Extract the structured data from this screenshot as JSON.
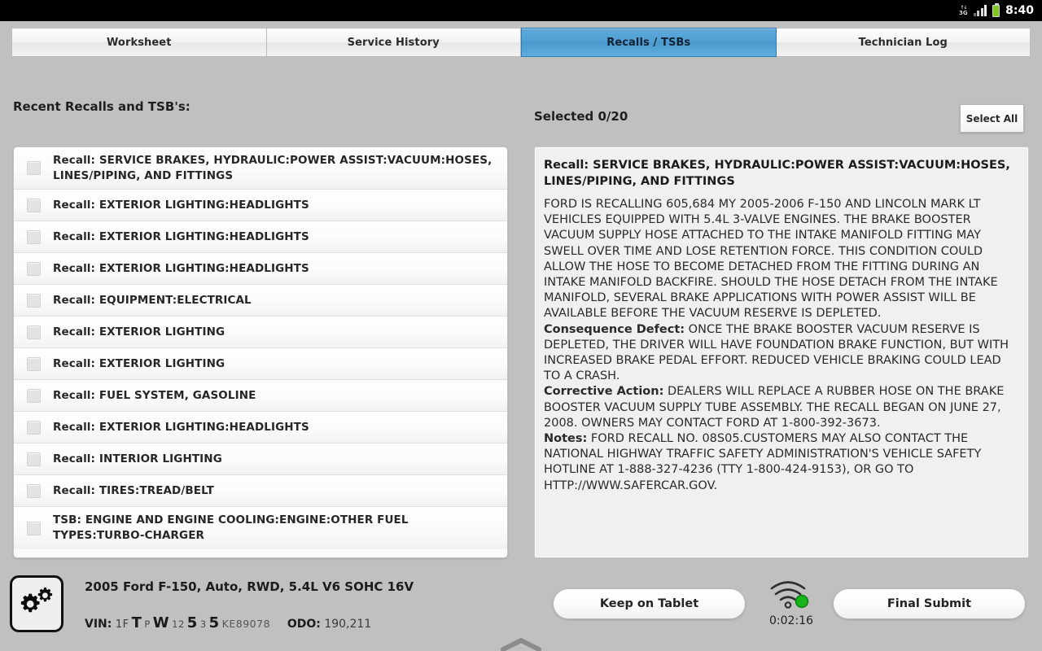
{
  "statusbar": {
    "network": "3G",
    "time": "8:40",
    "icons": [
      "3g-icon",
      "signal-icon",
      "battery-icon"
    ]
  },
  "tabs": [
    {
      "label": "Worksheet",
      "active": false
    },
    {
      "label": "Service History",
      "active": false
    },
    {
      "label": "Recalls / TSBs",
      "active": true
    },
    {
      "label": "Technician Log",
      "active": false
    }
  ],
  "left": {
    "heading": "Recent Recalls and TSB's:",
    "items": [
      {
        "label": "Recall: SERVICE BRAKES, HYDRAULIC:POWER ASSIST:VACUUM:HOSES, LINES/PIPING, AND FITTINGS",
        "tall": true,
        "checked": false
      },
      {
        "label": "Recall: EXTERIOR LIGHTING:HEADLIGHTS",
        "tall": false,
        "checked": false
      },
      {
        "label": "Recall: EXTERIOR LIGHTING:HEADLIGHTS",
        "tall": false,
        "checked": false
      },
      {
        "label": "Recall: EXTERIOR LIGHTING:HEADLIGHTS",
        "tall": false,
        "checked": false
      },
      {
        "label": "Recall: EQUIPMENT:ELECTRICAL",
        "tall": false,
        "checked": false
      },
      {
        "label": "Recall: EXTERIOR LIGHTING",
        "tall": false,
        "checked": false
      },
      {
        "label": "Recall: EXTERIOR LIGHTING",
        "tall": false,
        "checked": false
      },
      {
        "label": "Recall: FUEL SYSTEM, GASOLINE",
        "tall": false,
        "checked": false
      },
      {
        "label": "Recall: EXTERIOR LIGHTING:HEADLIGHTS",
        "tall": false,
        "checked": false
      },
      {
        "label": "Recall: INTERIOR LIGHTING",
        "tall": false,
        "checked": false
      },
      {
        "label": "Recall: TIRES:TREAD/BELT",
        "tall": false,
        "checked": false
      },
      {
        "label": "TSB: ENGINE AND ENGINE COOLING:ENGINE:OTHER FUEL TYPES:TURBO-CHARGER",
        "tall": true,
        "checked": false
      }
    ]
  },
  "right": {
    "selected_label": "Selected 0/20",
    "select_all_label": "Select All",
    "detail": {
      "title": "Recall: SERVICE BRAKES, HYDRAULIC:POWER ASSIST:VACUUM:HOSES, LINES/PIPING, AND FITTINGS",
      "summary": "FORD IS RECALLING 605,684 MY 2005-2006 F-150 AND LINCOLN MARK LT VEHICLES EQUIPPED WITH 5.4L 3-VALVE ENGINES. THE BRAKE BOOSTER VACUUM SUPPLY HOSE ATTACHED TO THE INTAKE MANIFOLD FITTING MAY SWELL OVER TIME AND LOSE RETENTION FORCE. THIS CONDITION COULD ALLOW THE HOSE TO BECOME DETACHED FROM THE FITTING DURING AN INTAKE MANIFOLD BACKFIRE. SHOULD THE HOSE DETACH FROM THE INTAKE MANIFOLD, SEVERAL BRAKE APPLICATIONS WITH POWER ASSIST WILL BE AVAILABLE BEFORE THE VACUUM RESERVE IS DEPLETED.",
      "consequence_label": "Consequence Defect:",
      "consequence": " ONCE THE BRAKE BOOSTER VACUUM RESERVE IS DEPLETED, THE DRIVER WILL HAVE FOUNDATION BRAKE FUNCTION, BUT WITH INCREASED BRAKE PEDAL EFFORT. REDUCED VEHICLE BRAKING COULD LEAD TO A CRASH.",
      "corrective_label": "Corrective Action:",
      "corrective": " DEALERS WILL REPLACE A RUBBER HOSE ON THE BRAKE BOOSTER VACUUM SUPPLY TUBE ASSEMBLY. THE RECALL BEGAN ON JUNE 27, 2008. OWNERS MAY CONTACT FORD AT 1-800-392-3673.",
      "notes_label": "Notes:",
      "notes": " FORD RECALL NO. 08S05.CUSTOMERS MAY ALSO CONTACT THE NATIONAL HIGHWAY TRAFFIC SAFETY ADMINISTRATION'S VEHICLE SAFETY HOTLINE AT 1-888-327-4236 (TTY 1-800-424-9153), OR GO TO HTTP://WWW.SAFERCAR.GOV."
    }
  },
  "footer": {
    "vehicle": "2005 Ford F-150, Auto, RWD, 5.4L V6 SOHC 16V",
    "vin_label": "VIN:",
    "vin_parts": [
      {
        "text": "1F",
        "style": "normal"
      },
      {
        "text": "T",
        "style": "big"
      },
      {
        "text": "P",
        "style": "small"
      },
      {
        "text": "W",
        "style": "big"
      },
      {
        "text": "12",
        "style": "small"
      },
      {
        "text": "5",
        "style": "big"
      },
      {
        "text": "3",
        "style": "small"
      },
      {
        "text": "5",
        "style": "big"
      },
      {
        "text": "KE89078",
        "style": "tail"
      }
    ],
    "vin_full": "1FTPW1255 3 5KE89078",
    "odo_label": "ODO:",
    "odo_value": "190,211",
    "keep_label": "Keep on Tablet",
    "final_label": "Final Submit",
    "timer": "0:02:16",
    "wifi_status_color": "#16b31a"
  }
}
